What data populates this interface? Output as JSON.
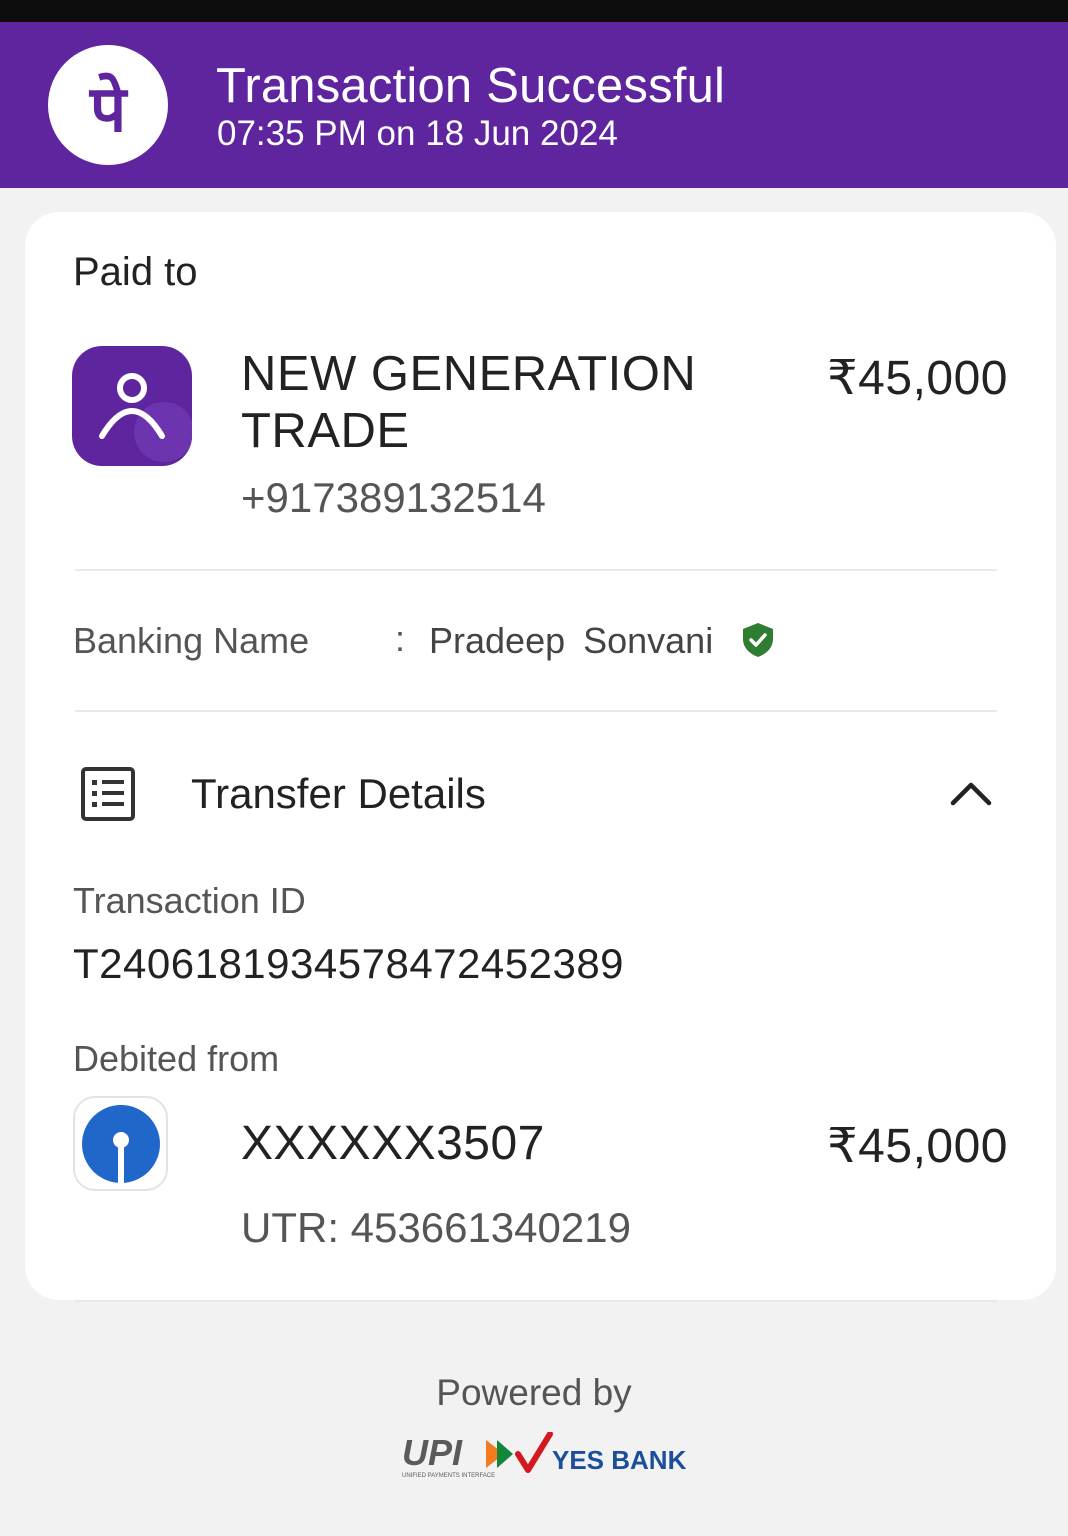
{
  "header": {
    "logo_glyph": "पे",
    "title": "Transaction Successful",
    "subtitle": "07:35 PM on 18 Jun 2024",
    "color": "#5f259f"
  },
  "payee": {
    "section_label": "Paid to",
    "name": "NEW GENERATION TRADE",
    "phone": "+917389132514",
    "amount": "₹45,000",
    "avatar_icon": "person-icon"
  },
  "banking": {
    "label": "Banking Name",
    "separator": ":",
    "value": "Pradeep Sonvani",
    "verified_icon": "shield-check-icon",
    "verified_color": "#2e7d32"
  },
  "transfer_details": {
    "title": "Transfer Details",
    "icon": "receipt-list-icon",
    "toggle_icon": "chevron-up-icon",
    "transaction_id_label": "Transaction ID",
    "transaction_id": "T2406181934578472452389",
    "debited_from_label": "Debited from",
    "account": "XXXXXX3507",
    "amount": "₹45,000",
    "utr": "UTR: 453661340219",
    "bank_logo_icon": "sbi-logo-icon"
  },
  "footer": {
    "powered_by": "Powered by",
    "upi_text": "UPI",
    "upi_subtext": "UNIFIED PAYMENTS INTERFACE",
    "bank_text": "YES BANK"
  }
}
